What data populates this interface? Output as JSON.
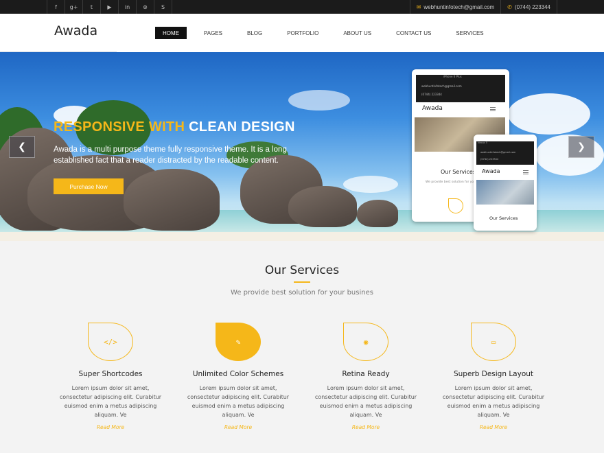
{
  "topbar": {
    "social": [
      {
        "icon": "facebook-icon",
        "glyph": "f"
      },
      {
        "icon": "google-plus-icon",
        "glyph": "g+"
      },
      {
        "icon": "twitter-icon",
        "glyph": "t"
      },
      {
        "icon": "youtube-icon",
        "glyph": "▶"
      },
      {
        "icon": "linkedin-icon",
        "glyph": "in"
      },
      {
        "icon": "dribbble-icon",
        "glyph": "⊛"
      },
      {
        "icon": "skype-icon",
        "glyph": "S"
      }
    ],
    "email": "webhuntinfotech@gmail.com",
    "phone": "(0744) 223344"
  },
  "header": {
    "logo": "Awada",
    "nav": [
      "HOME",
      "PAGES",
      "BLOG",
      "PORTFOLIO",
      "ABOUT US",
      "CONTACT US",
      "SERVICES"
    ],
    "active_nav": "HOME"
  },
  "hero": {
    "title_highlight": "RESPONSIVE WITH",
    "title_rest": "CLEAN DESIGN",
    "text": "Awada is a multi purpose theme fully responsive theme. It is a long established fact that a reader distracted by the readable content.",
    "button": "Purchase Now",
    "prev_glyph": "❮",
    "next_glyph": "❯",
    "device_large": {
      "label": "iPhone 6 Plus",
      "logo": "Awada",
      "heading": "Our Services",
      "sub": "We provide best solution for you",
      "email": "webhuntinfotech@gmail.com",
      "phone": "(0744) 223344"
    },
    "device_small": {
      "label": "Nexus 5",
      "logo": "Awada",
      "heading": "Our Services",
      "email": "webhuntinfotech@gmail.com",
      "phone": "(0744) 223344"
    }
  },
  "services": {
    "title": "Our Services",
    "subtitle": "We provide best solution for your busines",
    "items": [
      {
        "icon": "code-icon",
        "glyph": "</>",
        "title": "Super Shortcodes",
        "text": "Lorem ipsum dolor sit amet, consectetur adipiscing elit. Curabitur euismod enim a metus adipiscing aliquam. Ve",
        "more": "Read More",
        "filled": false
      },
      {
        "icon": "pencil-icon",
        "glyph": "✎",
        "title": "Unlimited Color Schemes",
        "text": "Lorem ipsum dolor sit amet, consectetur adipiscing elit. Curabitur euismod enim a metus adipiscing aliquam. Ve",
        "more": "Read More",
        "filled": true
      },
      {
        "icon": "eye-icon",
        "glyph": "◉",
        "title": "Retina Ready",
        "text": "Lorem ipsum dolor sit amet, consectetur adipiscing elit. Curabitur euismod enim a metus adipiscing aliquam. Ve",
        "more": "Read More",
        "filled": false
      },
      {
        "icon": "laptop-icon",
        "glyph": "▭",
        "title": "Superb Design Layout",
        "text": "Lorem ipsum dolor sit amet, consectetur adipiscing elit. Curabitur euismod enim a metus adipiscing aliquam. Ve",
        "more": "Read More",
        "filled": false
      }
    ]
  },
  "colors": {
    "accent": "#f5b719",
    "topbar": "#1b1b1b",
    "background": "#f3f3f3"
  }
}
